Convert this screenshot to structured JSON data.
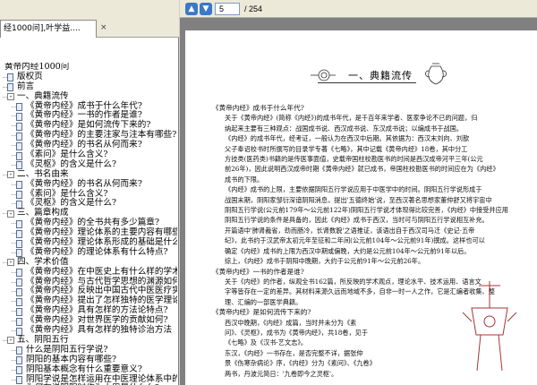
{
  "tab": {
    "title": "经1000问],叶学益....",
    "close": "×"
  },
  "toolbar": {
    "page_current": "5",
    "page_total": "/ 254",
    "prev_icon": "arrow-up-icon",
    "next_icon": "arrow-down-icon"
  },
  "tree": [
    {
      "level": 0,
      "toggle": "",
      "label": "黄帝内经1000问",
      "doc": false
    },
    {
      "level": 1,
      "toggle": "",
      "label": "版权页",
      "doc": true
    },
    {
      "level": 1,
      "toggle": "",
      "label": "前言",
      "doc": true
    },
    {
      "level": 1,
      "toggle": "-",
      "label": "一、典籍流传",
      "doc": false
    },
    {
      "level": 2,
      "toggle": "",
      "label": "《黄帝内经》成书于什么年代?",
      "doc": true
    },
    {
      "level": 2,
      "toggle": "",
      "label": "《黄帝内经》一书的作者是谁?",
      "doc": true
    },
    {
      "level": 2,
      "toggle": "",
      "label": "《黄帝内经》是如何流传下来的?",
      "doc": true
    },
    {
      "level": 2,
      "toggle": "",
      "label": "《黄帝内经》的主要注家与注本有哪些?",
      "doc": true
    },
    {
      "level": 2,
      "toggle": "",
      "label": "《黄帝内经》的书名从何而来?",
      "doc": true
    },
    {
      "level": 2,
      "toggle": "",
      "label": "《素问》是什么含义?",
      "doc": true
    },
    {
      "level": 2,
      "toggle": "",
      "label": "《灵枢》的含义是什么?",
      "doc": true
    },
    {
      "level": 1,
      "toggle": "-",
      "label": "二、书名由来",
      "doc": false
    },
    {
      "level": 2,
      "toggle": "",
      "label": "《黄帝内经》的书名从何而来?",
      "doc": true
    },
    {
      "level": 2,
      "toggle": "",
      "label": "《素问》是什么含义?",
      "doc": true
    },
    {
      "level": 2,
      "toggle": "",
      "label": "《灵枢》的含义是什么?",
      "doc": true
    },
    {
      "level": 1,
      "toggle": "-",
      "label": "三、篇章构成",
      "doc": false
    },
    {
      "level": 2,
      "toggle": "",
      "label": "《黄帝内经》的全书共有多少篇章?",
      "doc": true
    },
    {
      "level": 2,
      "toggle": "",
      "label": "《黄帝内经》理论体系的主要内容有哪些",
      "doc": true
    },
    {
      "level": 2,
      "toggle": "",
      "label": "《黄帝内经》理论体系形成的基础是什么",
      "doc": true
    },
    {
      "level": 2,
      "toggle": "",
      "label": "《黄帝内经》的理论体系有什么特点?",
      "doc": true
    },
    {
      "level": 1,
      "toggle": "-",
      "label": "四、学术价值",
      "doc": false
    },
    {
      "level": 2,
      "toggle": "",
      "label": "《黄帝内经》在中医史上有什么样的学术",
      "doc": true
    },
    {
      "level": 2,
      "toggle": "",
      "label": "《黄帝内经》与古代哲学思想的渊源如何",
      "doc": true
    },
    {
      "level": 2,
      "toggle": "",
      "label": "《黄帝内经》反映出中国古代中医医疗实",
      "doc": true
    },
    {
      "level": 2,
      "toggle": "",
      "label": "《黄帝内经》提出了怎样独特的医学理论",
      "doc": true
    },
    {
      "level": 2,
      "toggle": "",
      "label": "《黄帝内经》具有怎样的方法论特点?",
      "doc": true
    },
    {
      "level": 2,
      "toggle": "",
      "label": "《黄帝内经》对世界医学的贡献如何?",
      "doc": true
    },
    {
      "level": 2,
      "toggle": "",
      "label": "《黄帝内经》具有怎样的独特诊治方法",
      "doc": true
    },
    {
      "level": 1,
      "toggle": "-",
      "label": "五、阴阳五行",
      "doc": false
    },
    {
      "level": 2,
      "toggle": "",
      "label": "什么是阴阳五行学说?",
      "doc": true
    },
    {
      "level": 2,
      "toggle": "",
      "label": "阴阳的基本内容有哪些?",
      "doc": true
    },
    {
      "level": 2,
      "toggle": "",
      "label": "阴阳基本概念有什么重要意义?",
      "doc": true
    },
    {
      "level": 2,
      "toggle": "",
      "label": "阴阳学说是怎样运用在中医理论体系中的",
      "doc": true
    },
    {
      "level": 2,
      "toggle": "",
      "label": "为何在说阴阳时作为大用是什么么?",
      "doc": true
    }
  ],
  "page": {
    "section_title": "一、典籍流传",
    "paragraphs": [
      {
        "q": true,
        "t": "《黄帝内经》成书于什么年代?"
      },
      {
        "q": false,
        "t": "关于《黄帝内经》(简称《内经》)的成书年代，是千百年来学者、医家争论不已的问题，归"
      },
      {
        "q": false,
        "t": "纳起来主要有三种观点：战国成书说、西汉成书说、东汉成书说；以编成书于战国。"
      },
      {
        "q": false,
        "t": "《内经》的成书年代，经考证，一般认为在西汉中后期。其依据为：西汉末刘向、刘歆"
      },
      {
        "q": false,
        "t": "父子奉诏校书时所撰写的目录学专著《七略》，其中记载《黄帝内经》18卷，其中分工"
      },
      {
        "q": false,
        "t": "方技类(医药类)书籍的是传医事面值，史载帝国柱校勘医书的时间是西汉成帝河平三年(公元"
      },
      {
        "q": false,
        "t": "前26年)，因此说明西汉成帝时期《黄帝内经》就已成书，帝国柱校勘医书的时间应在为《内经》"
      },
      {
        "q": false,
        "t": "成书的下限。"
      },
      {
        "q": false,
        "t": "《内经》成书的上限，主要依据阴阳五行学说应用于中医学中的时间。阴阳五行学说形成于"
      },
      {
        "q": false,
        "t": "战国末期，阴阳家邹衍深谙阴阳消息，提出'五德终始'说，至西汉著名思想家董仲舒又将宇宙中"
      },
      {
        "q": false,
        "t": "阴阳五行学说(公元前179年～公元前122年)阴阳五行学说才体现得比较完善，《内经》中接受并应用"
      },
      {
        "q": false,
        "t": "阴阳五行学说的条件是具备的，因此《内经》成书于西汉，当时可与阴阳五行学说相互补充。"
      },
      {
        "q": false,
        "t": "开篇语中'肺肾裁省，劲而肠冷，长肾数貌'之语推证，该语出自于西汉司马迁《史记·五帝"
      },
      {
        "q": false,
        "t": "纪》，此书约于汉武帝太初元年至征和二年间(公元前104年～公元前91年)撰成。这样也可以"
      },
      {
        "q": false,
        "t": "确定《内经》成书的上限为西汉中期或偏晚，大约是公元前104年～公元前91年以后。"
      },
      {
        "q": false,
        "t": "综上，《内经》成书于阴阳中晚期，大约于公元前91年～公元前26年。"
      },
      {
        "q": true,
        "t": "《黄帝内经》一书的作者是谁?"
      },
      {
        "q": false,
        "t": "关于《内经》的作者，纵观全书162篇，所反映的学术观点，理论水平、技术运用、语言文"
      },
      {
        "q": false,
        "t": "字等皆存在一定的差异。其材料来源久远而地域不多，自非一时一人之作，它是汇编者收集、整"
      },
      {
        "q": false,
        "t": "理、汇编的一部医学典籍。"
      },
      {
        "q": true,
        "t": "《黄帝内经》是如何流传下来的?"
      },
      {
        "q": false,
        "t": "西汉中晚期，《内经》成篇，当时并未分为《素"
      },
      {
        "q": false,
        "t": "问》、《灵枢》，成书为《黄帝内经》，共18卷，见于"
      },
      {
        "q": false,
        "t": "《七略》及《汉书·艺文志》。"
      },
      {
        "q": false,
        "t": "东汉，《内经》一书存在，是否完整不详，据张仲"
      },
      {
        "q": false,
        "t": "景《伤寒杂病论》序，《内经》分为《素问》、《九卷》"
      },
      {
        "q": false,
        "t": "两书，丹波元简日：'九卷即今之灵枢'。"
      }
    ]
  }
}
